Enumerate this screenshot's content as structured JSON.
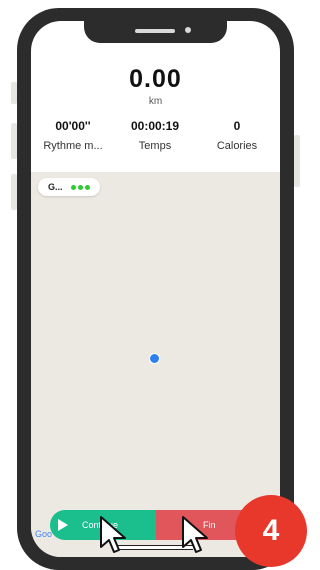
{
  "distance": {
    "value": "0.00",
    "unit": "km"
  },
  "stats": [
    {
      "value": "00'00''",
      "label": "Rythme m..."
    },
    {
      "value": "00:00:19",
      "label": "Temps"
    },
    {
      "value": "0",
      "label": "Calories"
    }
  ],
  "gps_indicator": {
    "label": "G...",
    "status_color": "#2ecc2e"
  },
  "map": {
    "attribution": "Goo"
  },
  "controls": {
    "continue_label": "Continue",
    "end_label": "Fin",
    "continue_color": "#1bbf8d",
    "end_color": "#e0565a"
  },
  "step_badge": {
    "number": "4",
    "color": "#e8372b"
  }
}
